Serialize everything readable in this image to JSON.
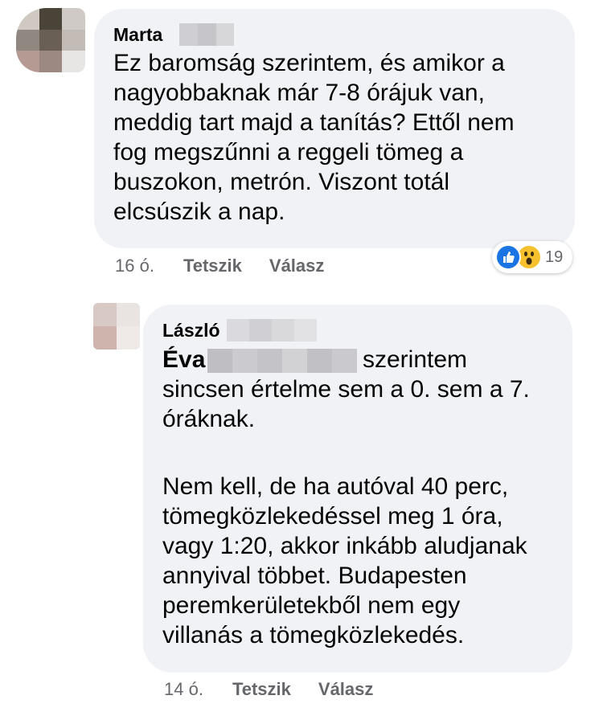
{
  "comments": [
    {
      "author": "Marta",
      "lines": [
        "Ez baromság szerintem, és amikor a",
        "nagyobbaknak már 7-8 órájuk van,",
        "meddig tart majd a  tanítás? Ettől nem",
        "fog megszűnni a reggeli tömeg a",
        "buszokon, metrón. Viszont totál",
        "elcsúszik a nap."
      ],
      "time": "16 ó.",
      "like_label": "Tetszik",
      "reply_label": "Válasz",
      "reaction_count": "19",
      "reaction_icons": [
        "like-icon",
        "wow-icon"
      ],
      "colors": {
        "like": "#1b74e4",
        "wow": "#f7c12e"
      }
    },
    {
      "author": "László",
      "mention": "Éva",
      "first_line_rest": "szerintem",
      "lines_para1": [
        "sincsen értelme sem a 0. sem a 7.",
        "óráknak."
      ],
      "lines_para2": [
        "Nem kell, de ha autóval 40 perc,",
        "tömegközlekedéssel meg 1 óra,",
        "vagy 1:20, akkor inkább aludjanak",
        "annyival többet. Budapesten",
        "peremkerületekből nem egy",
        "villanás a tömegközlekedés."
      ],
      "time": "14 ó.",
      "like_label": "Tetszik",
      "reply_label": "Válasz"
    }
  ],
  "theme": {
    "bubble_bg": "#f0f2f5",
    "meta_text": "#65676b",
    "text": "#050505"
  }
}
